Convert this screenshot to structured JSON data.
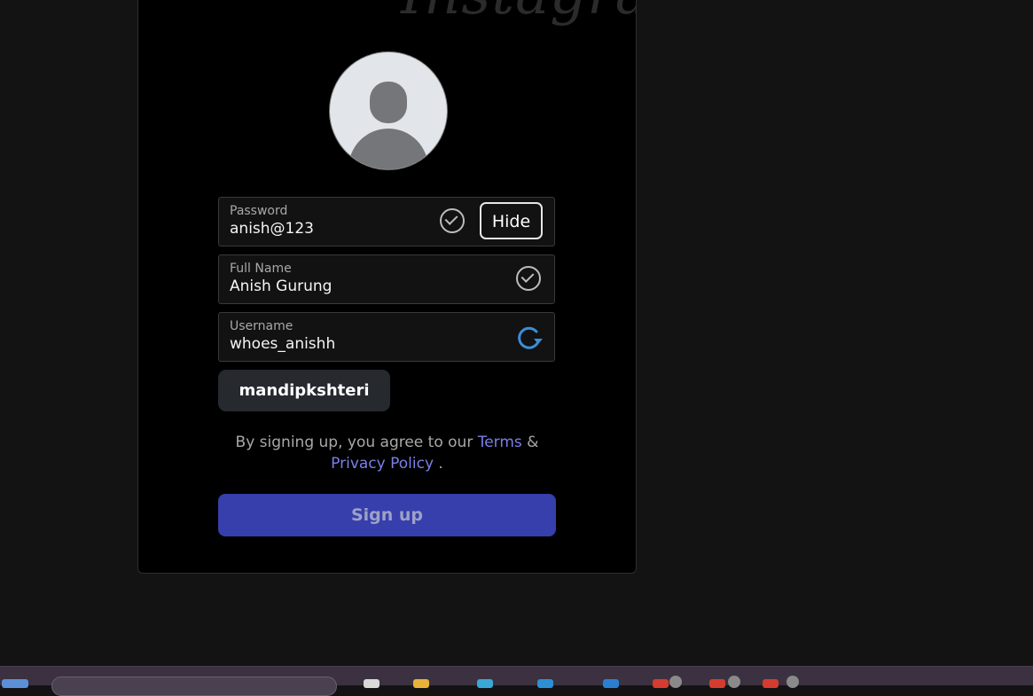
{
  "logo_text": "Instagram",
  "fields": {
    "password": {
      "label": "Password",
      "value": "anish@123",
      "toggle_label": "Hide"
    },
    "full_name": {
      "label": "Full Name",
      "value": "Anish Gurung"
    },
    "username": {
      "label": "Username",
      "value": "whoes_anishh"
    }
  },
  "suggestion": "mandipkshteri",
  "terms": {
    "prefix": "By signing up, you agree to our ",
    "terms_link": "Terms",
    "ampersand": " & ",
    "privacy_link": "Privacy Policy",
    "suffix": " ."
  },
  "signup_label": "Sign up",
  "colors": {
    "accent_button": "#363fab",
    "link": "#7b7fe8",
    "refresh_icon": "#3b8ed8"
  }
}
